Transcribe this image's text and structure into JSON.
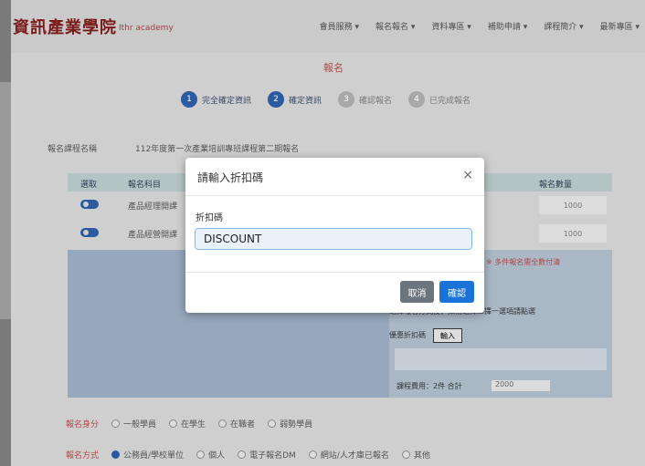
{
  "header": {
    "logo": "資訊產業學院",
    "logo_sub": "Ithr academy",
    "nav": [
      "會員服務 ▾",
      "報名報名 ▾",
      "資料專區 ▾",
      "補助申請 ▾",
      "課程簡介 ▾",
      "最新專區 ▾"
    ]
  },
  "section_title": "報名",
  "steps": [
    {
      "num": "1",
      "label": "完全確定資訊"
    },
    {
      "num": "2",
      "label": "確定資訊"
    },
    {
      "num": "3",
      "label": "確認報名"
    },
    {
      "num": "4",
      "label": "已完成報名"
    }
  ],
  "course": {
    "label": "報名課程名稱",
    "value": "112年度第一次產業培訓專班課程第二期報名"
  },
  "table": {
    "headers": [
      "選取",
      "報名科目",
      "報名數量"
    ],
    "rows": [
      {
        "name": "產品經理開課",
        "qty": "1000"
      },
      {
        "name": "產品經營開課",
        "qty": "1000"
      }
    ]
  },
  "lower": {
    "note": "選擇報名方式後，如需選擇二擇一選項請點選",
    "discount_label": "優惠折扣碼",
    "discount_btn": "輸入",
    "total_label": "課程費用：2件 合計",
    "total_value": "2000",
    "red_note": "※ 多件報名需全數付清"
  },
  "options": [
    {
      "key": "報名身分",
      "items": [
        "一般學員",
        "在學生",
        "在職者",
        "弱勢學員"
      ],
      "selected": -1
    },
    {
      "key": "報名方式",
      "items": [
        "公務員/學校單位",
        "個人",
        "電子報名DM",
        "網站/人才庫已報名",
        "其他"
      ],
      "selected": 0
    }
  ],
  "modal": {
    "title": "請輸入折扣碼",
    "close": "×",
    "field_label": "折扣碼",
    "field_value": "DISCOUNT",
    "cancel": "取消",
    "ok": "確認"
  }
}
